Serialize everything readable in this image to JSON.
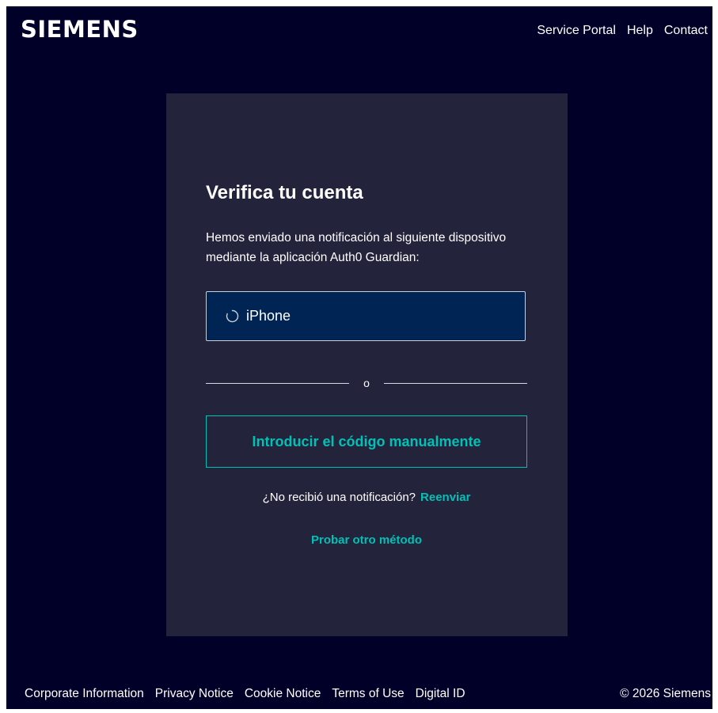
{
  "header": {
    "logo_text": "SIEMENS",
    "nav": [
      {
        "label": "Service Portal"
      },
      {
        "label": "Help"
      },
      {
        "label": "Contact"
      }
    ]
  },
  "card": {
    "title": "Verifica tu cuenta",
    "description": "Hemos enviado una notificación al siguiente dispositivo mediante la aplicación Auth0 Guardian:",
    "device": {
      "label": "iPhone",
      "icon": "spinner-icon"
    },
    "divider_text": "o",
    "manual_button_label": "Introducir el código manualmente",
    "resend_prompt": "¿No recibió una notificación?",
    "resend_link": "Reenviar",
    "other_method_link": "Probar otro método"
  },
  "footer": {
    "links": [
      {
        "label": "Corporate Information"
      },
      {
        "label": "Privacy Notice"
      },
      {
        "label": "Cookie Notice"
      },
      {
        "label": "Terms of Use"
      },
      {
        "label": "Digital ID"
      }
    ],
    "copyright": "© 2026 Siemens"
  },
  "colors": {
    "page_background": "#000028",
    "card_background": "#23233c",
    "device_background": "#002554",
    "accent": "#00c1b6",
    "text": "#ffffff"
  }
}
